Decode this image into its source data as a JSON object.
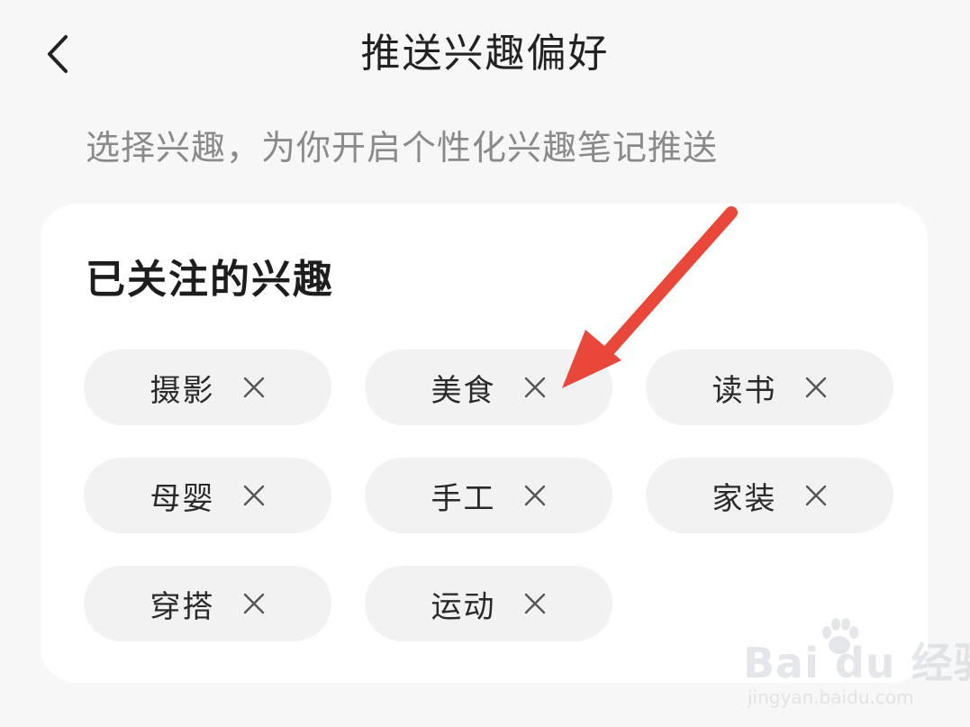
{
  "header": {
    "title": "推送兴趣偏好",
    "back_icon": "chevron-left-icon"
  },
  "subtitle": "选择兴趣，为你开启个性化兴趣笔记推送",
  "section": {
    "title": "已关注的兴趣",
    "chips": [
      {
        "label": "摄影"
      },
      {
        "label": "美食"
      },
      {
        "label": "读书"
      },
      {
        "label": "母婴"
      },
      {
        "label": "手工"
      },
      {
        "label": "家装"
      },
      {
        "label": "穿搭"
      },
      {
        "label": "运动"
      }
    ],
    "remove_icon": "close-icon"
  },
  "annotation": {
    "color": "#e8473a"
  },
  "watermark": {
    "brand": "Bai du 经验",
    "url": "jingyan.baidu.com"
  }
}
